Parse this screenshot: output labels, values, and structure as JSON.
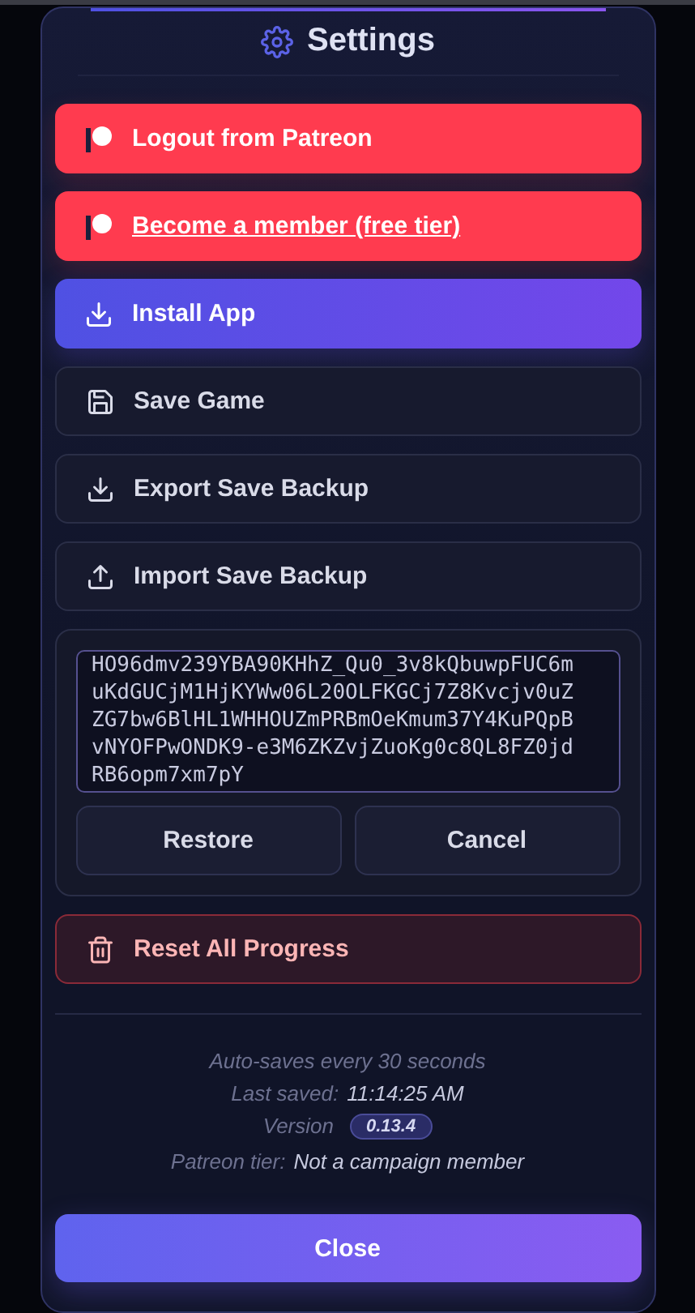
{
  "title": "Settings",
  "actions": [
    {
      "label": "Logout from Patreon",
      "kind": "patreon",
      "underlined": false
    },
    {
      "label": "Become a member (free tier)",
      "kind": "patreon",
      "underlined": true
    },
    {
      "label": "Install App",
      "kind": "install",
      "underlined": false
    },
    {
      "label": "Save Game",
      "kind": "save",
      "underlined": false
    },
    {
      "label": "Export Save Backup",
      "kind": "export",
      "underlined": false
    },
    {
      "label": "Import Save Backup",
      "kind": "import",
      "underlined": false
    }
  ],
  "backup": {
    "value": "HO96dmv239YBA90KHhZ_Qu0_3v8kQbuwpFUC6muKdGUCjM1HjKYWw06L20OLFKGCj7Z8Kvcjv0uZZG7bw6BlHL1WHHOUZmPRBmOeKmum37Y4KuPQpBvNYOFPwONDK9-e3M6ZKZvjZuoKg0c8QL8FZ0jdRB6opm7xm7pY",
    "buttons": [
      "Restore",
      "Cancel"
    ]
  },
  "reset": {
    "label": "Reset All Progress"
  },
  "info": [
    {
      "label": "Auto-saves every 30 seconds"
    },
    {
      "label": "Last saved:",
      "value": "11:14:25 AM",
      "kind": "text"
    },
    {
      "label": "Version",
      "value": "0.13.4",
      "kind": "badge"
    },
    {
      "label": "Patreon tier:",
      "value": "Not a campaign member",
      "kind": "text"
    }
  ],
  "close": "Close"
}
